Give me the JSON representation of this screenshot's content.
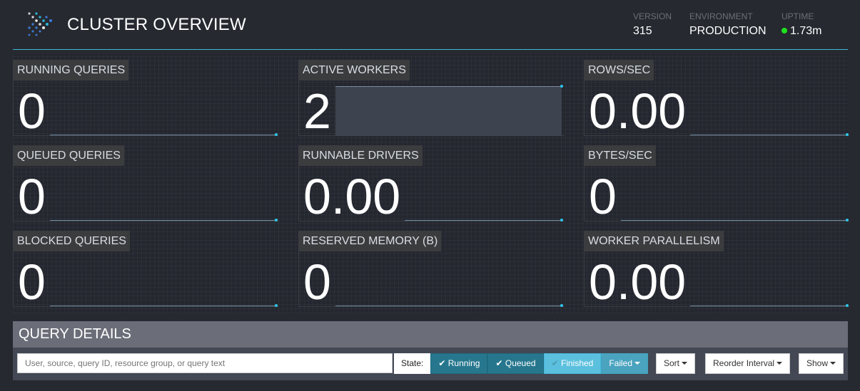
{
  "header": {
    "title": "CLUSTER OVERVIEW",
    "version_label": "VERSION",
    "version": "315",
    "environment_label": "ENVIRONMENT",
    "environment": "PRODUCTION",
    "uptime_label": "UPTIME",
    "uptime": "1.73m",
    "uptime_status_color": "#1fe21f",
    "accent": "#3fb9d9"
  },
  "tiles": [
    {
      "label": "RUNNING QUERIES",
      "value": "0"
    },
    {
      "label": "ACTIVE WORKERS",
      "value": "2"
    },
    {
      "label": "ROWS/SEC",
      "value": "0.00"
    },
    {
      "label": "QUEUED QUERIES",
      "value": "0"
    },
    {
      "label": "RUNNABLE DRIVERS",
      "value": "0.00"
    },
    {
      "label": "BYTES/SEC",
      "value": "0"
    },
    {
      "label": "BLOCKED QUERIES",
      "value": "0"
    },
    {
      "label": "RESERVED MEMORY (B)",
      "value": "0"
    },
    {
      "label": "WORKER PARALLELISM",
      "value": "0.00"
    }
  ],
  "query_details": {
    "title": "QUERY DETAILS",
    "search_placeholder": "User, source, query ID, resource group, or query text",
    "state_label": "State:",
    "states": [
      {
        "label": "Running",
        "checked": true
      },
      {
        "label": "Queued",
        "checked": true
      },
      {
        "label": "Finished",
        "checked": false
      },
      {
        "label": "Failed"
      }
    ],
    "sort_label": "Sort",
    "reorder_label": "Reorder Interval",
    "show_label": "Show"
  }
}
